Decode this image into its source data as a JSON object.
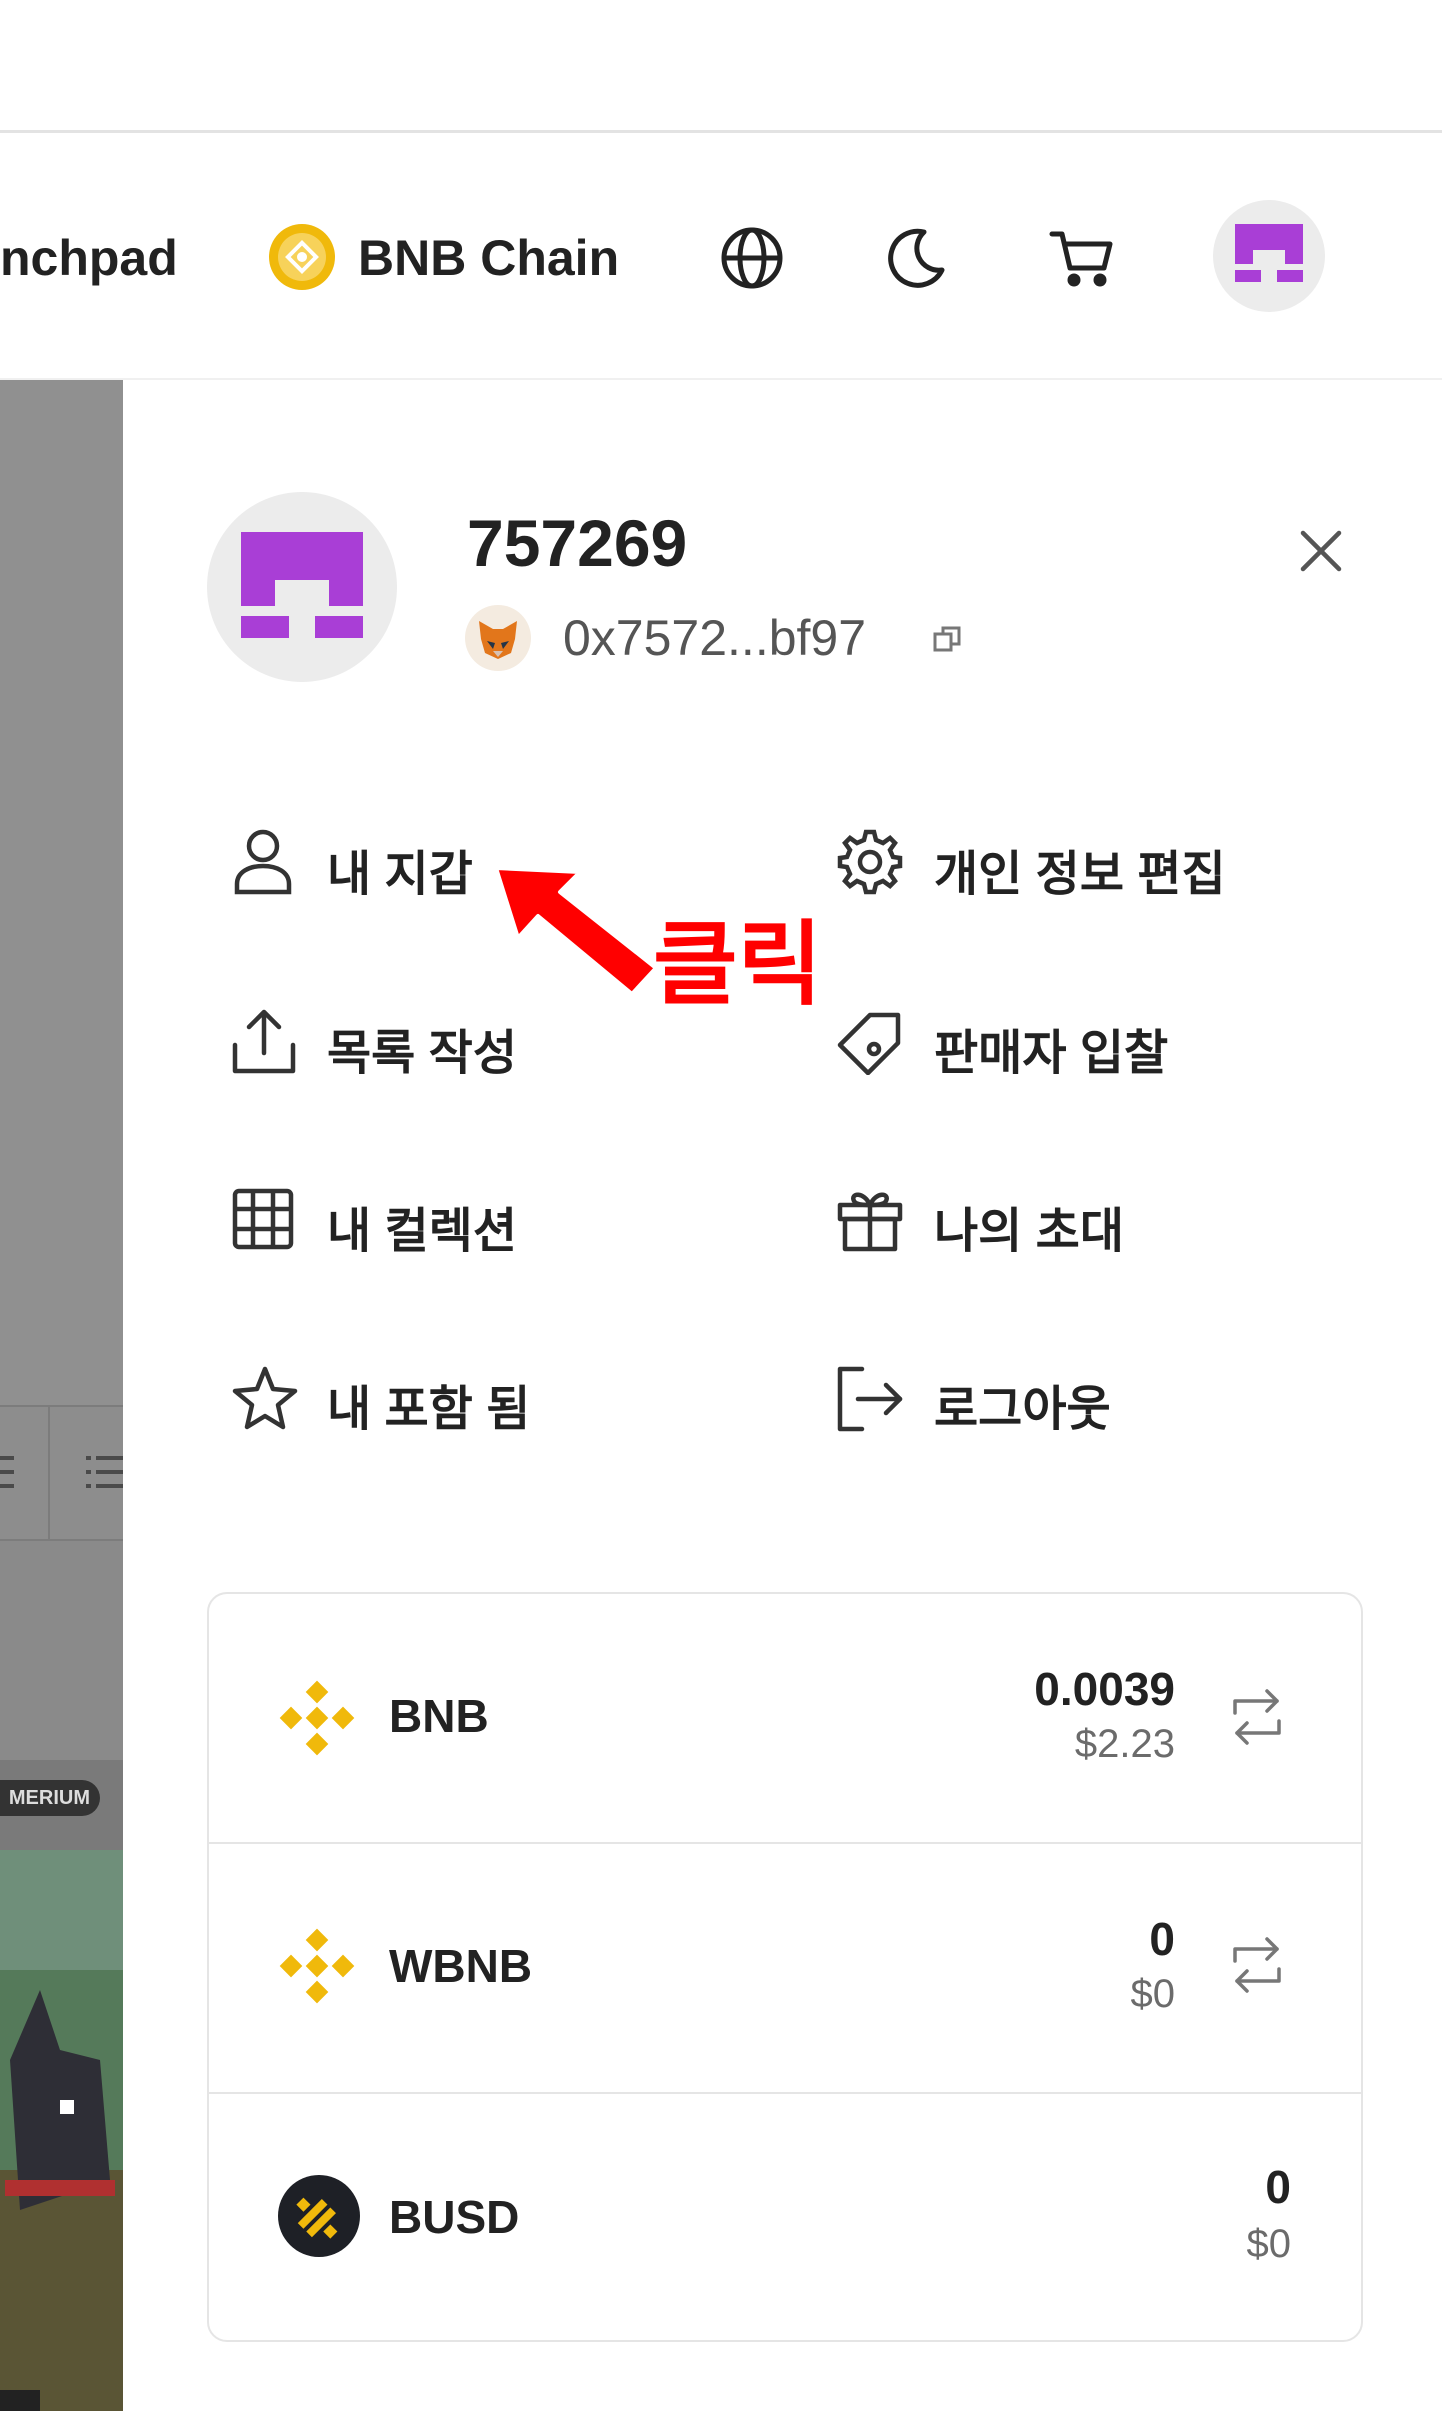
{
  "header": {
    "launchpad_label": "nchpad",
    "chain_label": "BNB Chain",
    "icons": [
      "globe-icon",
      "moon-icon",
      "cart-icon",
      "avatar"
    ]
  },
  "profile": {
    "name": "757269",
    "address": "0x7572...bf97",
    "wallet_icon": "metamask-fox-icon"
  },
  "menu": {
    "items": [
      {
        "label": "내 지갑",
        "icon": "user-icon"
      },
      {
        "label": "개인 정보 편집",
        "icon": "gear-icon"
      },
      {
        "label": "목록 작성",
        "icon": "upload-icon"
      },
      {
        "label": "판매자 입찰",
        "icon": "tag-icon"
      },
      {
        "label": "내 컬렉션",
        "icon": "grid-icon"
      },
      {
        "label": "나의 초대",
        "icon": "gift-icon"
      },
      {
        "label": "내 포함 됨",
        "icon": "star-icon"
      },
      {
        "label": "로그아웃",
        "icon": "logout-icon"
      }
    ]
  },
  "annotation": {
    "text": "클릭",
    "color": "#ff0000"
  },
  "tokens": [
    {
      "symbol": "BNB",
      "amount": "0.0039",
      "usd": "$2.23",
      "icon": "bnb-icon",
      "swap": true
    },
    {
      "symbol": "WBNB",
      "amount": "0",
      "usd": "$0",
      "icon": "bnb-icon",
      "swap": true
    },
    {
      "symbol": "BUSD",
      "amount": "0",
      "usd": "$0",
      "icon": "busd-icon",
      "swap": false
    }
  ],
  "backdrop": {
    "badge_text": "MERIUM"
  },
  "colors": {
    "accent_purple": "#a93ed6",
    "bnb_gold": "#f0b90b",
    "annotation_red": "#ff0000"
  }
}
